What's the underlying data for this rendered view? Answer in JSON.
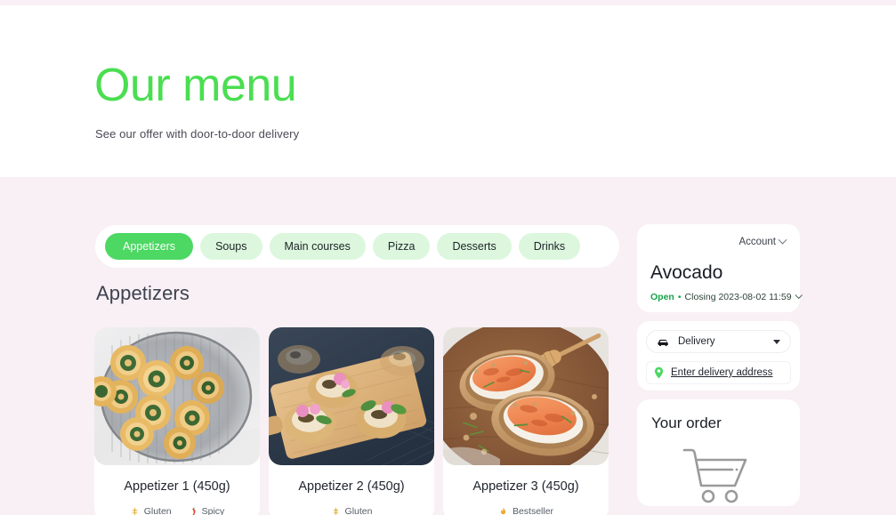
{
  "hero": {
    "title": "Our menu",
    "subtitle": "See our offer with door-to-door delivery",
    "title_color": "#4ade51"
  },
  "tabs": {
    "items": [
      {
        "label": "Appetizers",
        "active": true
      },
      {
        "label": "Soups",
        "active": false
      },
      {
        "label": "Main courses",
        "active": false
      },
      {
        "label": "Pizza",
        "active": false
      },
      {
        "label": "Desserts",
        "active": false
      },
      {
        "label": "Drinks",
        "active": false
      }
    ],
    "active_bg": "#4cd863",
    "inactive_bg": "#dcf7dd"
  },
  "section": {
    "heading": "Appetizers"
  },
  "products": [
    {
      "title": "Appetizer 1 (450g)",
      "image_alt": "spinach-pinwheel-pastries-on-wire-rack",
      "badges": [
        {
          "label": "Gluten",
          "icon": "wheat-icon",
          "color": "#e2b23c"
        },
        {
          "label": "Spicy",
          "icon": "chili-icon",
          "color": "#e34b3a"
        }
      ]
    },
    {
      "title": "Appetizer 2 (450g)",
      "image_alt": "mini-tarts-with-edible-flowers-on-wooden-board",
      "badges": [
        {
          "label": "Gluten",
          "icon": "wheat-icon",
          "color": "#e2b23c"
        }
      ]
    },
    {
      "title": "Appetizer 3 (450g)",
      "image_alt": "salmon-toasts-with-cream-cheese-on-wooden-board",
      "badges": [
        {
          "label": "Bestseller",
          "icon": "flame-icon",
          "color": "#f0a830"
        }
      ]
    }
  ],
  "rail": {
    "account": {
      "link_label": "Account",
      "restaurant_name": "Avocado",
      "status_label": "Open",
      "status_separator": "•",
      "status_detail": "Closing 2023-08-02 11:59",
      "status_color": "#16a34a"
    },
    "delivery": {
      "method_label": "Delivery",
      "address_label": "Enter delivery address",
      "pin_color": "#4cd863"
    },
    "order": {
      "title": "Your order",
      "empty_icon": "shopping-cart-icon"
    }
  }
}
